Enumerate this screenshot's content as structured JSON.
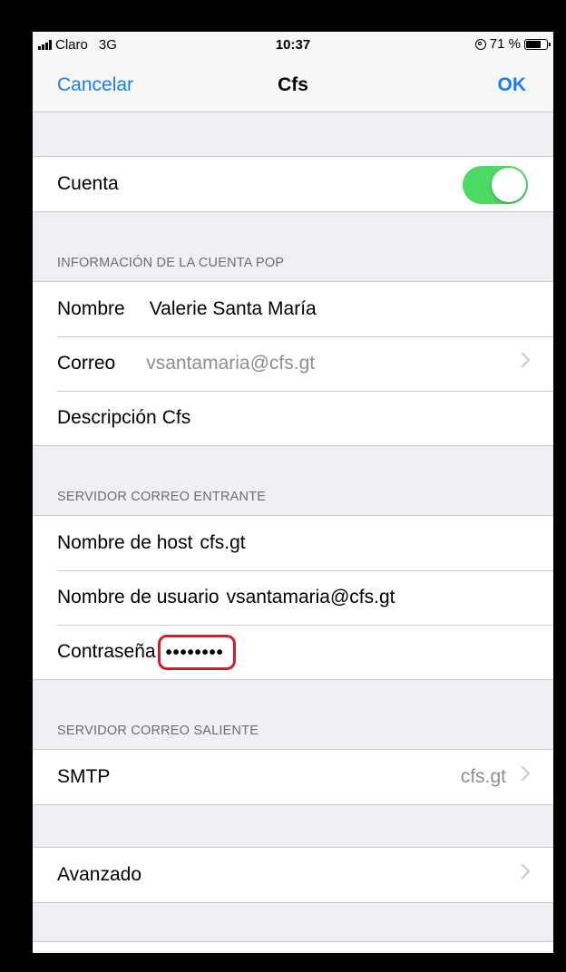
{
  "status_bar": {
    "carrier": "Claro",
    "network": "3G",
    "time": "10:37",
    "battery_percent": "71 %",
    "battery_level": 0.71
  },
  "nav": {
    "cancel_label": "Cancelar",
    "title": "Cfs",
    "ok_label": "OK"
  },
  "account": {
    "label": "Cuenta",
    "enabled": true
  },
  "pop_section": {
    "header": "INFORMACIÓN DE LA CUENTA POP",
    "name_label": "Nombre",
    "name_value": "Valerie Santa María",
    "email_label": "Correo",
    "email_value": "vsantamaria@cfs.gt",
    "description_label": "Descripción",
    "description_value": "Cfs"
  },
  "incoming": {
    "header": "SERVIDOR CORREO ENTRANTE",
    "host_label": "Nombre de host",
    "host_value": "cfs.gt",
    "user_label": "Nombre de usuario",
    "user_value": "vsantamaria@cfs.gt",
    "password_label": "Contraseña",
    "password_value": "••••••••"
  },
  "outgoing": {
    "header": "SERVIDOR CORREO SALIENTE",
    "smtp_label": "SMTP",
    "smtp_value": "cfs.gt"
  },
  "advanced": {
    "label": "Avanzado"
  },
  "colors": {
    "ios_blue": "#1a7ee8",
    "toggle_on": "#4cd964",
    "highlight_red": "#cc1f2a",
    "background": "#efeff4"
  }
}
